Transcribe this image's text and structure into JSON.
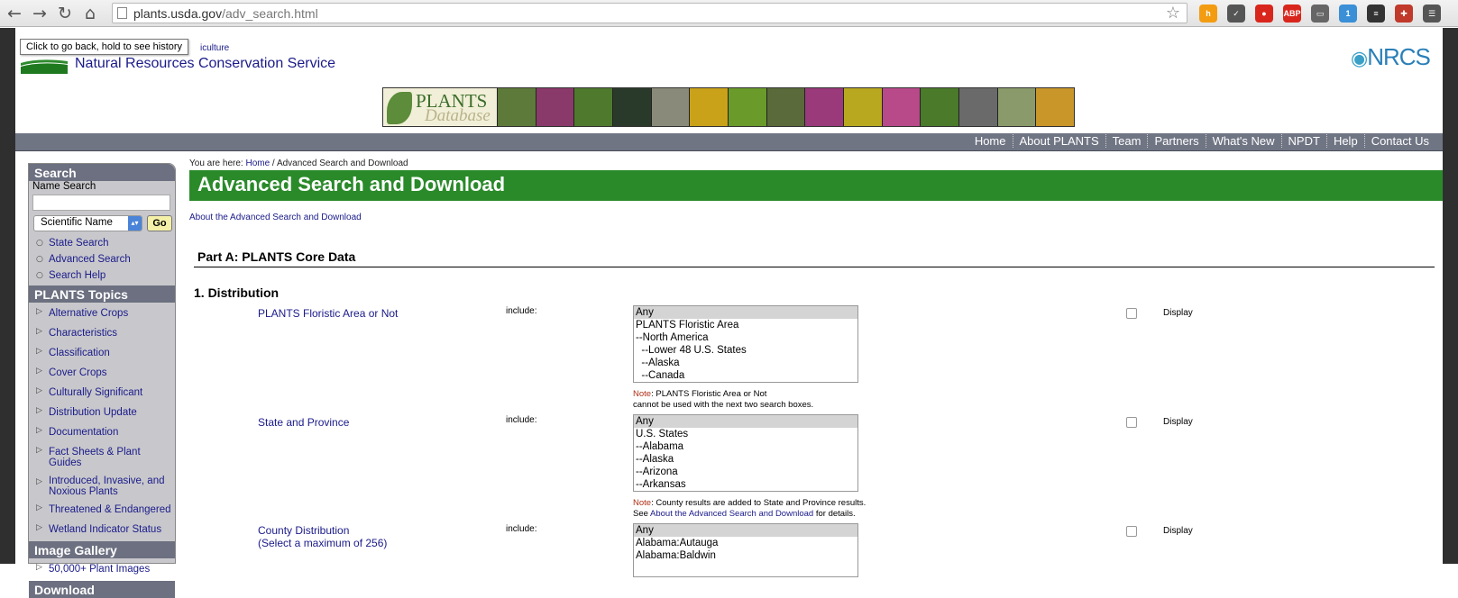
{
  "browser": {
    "url_domain": "plants.usda.gov",
    "url_path": "/adv_search.html",
    "tooltip": "Click to go back, hold to see history",
    "extensions": [
      {
        "name": "honey-icon",
        "color": "#f39c12",
        "label": "h"
      },
      {
        "name": "pocket-icon",
        "color": "#555555",
        "label": "✓"
      },
      {
        "name": "stop-icon",
        "color": "#d9261c",
        "label": "●"
      },
      {
        "name": "adblock-icon",
        "color": "#d9261c",
        "label": "ABP"
      },
      {
        "name": "cast-icon",
        "color": "#666666",
        "label": "▭"
      },
      {
        "name": "ghostery-icon",
        "color": "#3a8fd6",
        "label": "1"
      },
      {
        "name": "buffer-icon",
        "color": "#333333",
        "label": "≡"
      },
      {
        "name": "plus-icon",
        "color": "#c0392b",
        "label": "✚"
      },
      {
        "name": "menu-icon",
        "color": "#555555",
        "label": "☰"
      }
    ]
  },
  "header": {
    "usda_subtitle": "iculture",
    "nrcs_name": "Natural Resources Conservation Service",
    "nrcs_logo": "NRCS",
    "plants_logo_word1": "PLANTS",
    "plants_logo_word2": "Database"
  },
  "banner_tiles": [
    "#5e7a3a",
    "#8a3a6a",
    "#4f7a2e",
    "#2a3a2a",
    "#8a8a7a",
    "#c9a21a",
    "#6a9a2a",
    "#5a6a3a",
    "#9a3a7a",
    "#b8a820",
    "#b84a8a",
    "#4a7a2a",
    "#6a6a6a",
    "#8a9a6a",
    "#c9962a"
  ],
  "topnav": [
    "Home",
    "About PLANTS",
    "Team",
    "Partners",
    "What's New",
    "NPDT",
    "Help",
    "Contact Us"
  ],
  "sidebar": {
    "search_title": "Search",
    "name_search_label": "Name Search",
    "select_value": "Scientific Name",
    "go_label": "Go",
    "search_links": [
      "State Search",
      "Advanced Search",
      "Search Help"
    ],
    "topics_title": "PLANTS Topics",
    "topics": [
      "Alternative Crops",
      "Characteristics",
      "Classification",
      "Cover Crops",
      "Culturally Significant",
      "Distribution Update",
      "Documentation",
      "Fact Sheets & Plant Guides",
      "Introduced, Invasive, and Noxious Plants",
      "Threatened & Endangered",
      "Wetland Indicator Status"
    ],
    "gallery_title": "Image Gallery",
    "gallery_links": [
      "50,000+ Plant Images"
    ],
    "download_title": "Download"
  },
  "main": {
    "breadcrumb_prefix": "You are here: ",
    "breadcrumb_home": "Home",
    "breadcrumb_sep": " / ",
    "breadcrumb_current": "Advanced Search and Download",
    "title": "Advanced Search and Download",
    "about_link": "About the Advanced Search and Download",
    "part_a": "Part A: PLANTS Core Data",
    "section_distribution": "1. Distribution",
    "include_label": "include:",
    "display_label": "Display",
    "fields": [
      {
        "label": "PLANTS Floristic Area or Not",
        "options": [
          "Any",
          "PLANTS Floristic Area",
          "--North America",
          "  --Lower 48 U.S. States",
          "  --Alaska",
          "  --Canada"
        ],
        "note_prefix": "Note",
        "note_line1": ": PLANTS Floristic Area or Not",
        "note_line2": "cannot be used with the next two search boxes."
      },
      {
        "label": "State and Province",
        "options": [
          "Any",
          "U.S. States",
          "--Alabama",
          "--Alaska",
          "--Arizona",
          "--Arkansas"
        ],
        "note_prefix": "Note",
        "note_line1": ": County results are added to State and Province results.",
        "note_line2_pre": "See ",
        "note_line2_link": "About the Advanced Search and Download",
        "note_line2_post": " for details."
      },
      {
        "label_line1": "County Distribution",
        "label_line2": "(Select a maximum of 256)",
        "options": [
          "Any",
          "Alabama:Autauga",
          "Alabama:Baldwin"
        ]
      }
    ]
  }
}
